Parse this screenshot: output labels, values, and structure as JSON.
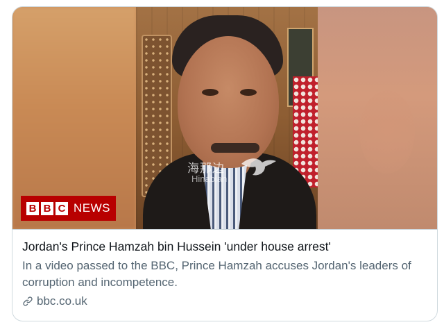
{
  "card": {
    "title": "Jordan's Prince Hamzah bin Hussein 'under house arrest'",
    "description": "In a video passed to the BBC, Prince Hamzah accuses Jordan's leaders of corruption and incompetence.",
    "domain": "bbc.co.uk",
    "link_icon": "link-icon"
  },
  "media": {
    "logo": {
      "letters": [
        "B",
        "B",
        "C"
      ],
      "word": "NEWS",
      "color": "#b80000"
    },
    "watermark": {
      "text": "海那边",
      "sub": "Hinabian"
    }
  },
  "colors": {
    "title": "#0f1419",
    "secondary": "#536471",
    "border": "#cfd9de"
  }
}
